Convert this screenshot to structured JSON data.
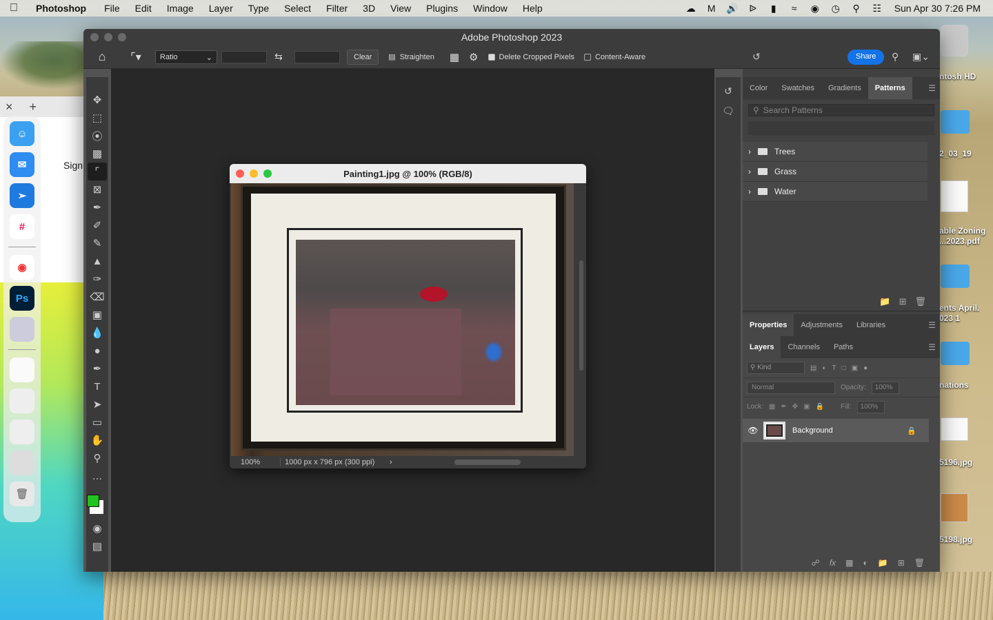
{
  "menubar": {
    "app": "Photoshop",
    "items": [
      "File",
      "Edit",
      "Image",
      "Layer",
      "Type",
      "Select",
      "Filter",
      "3D",
      "View",
      "Plugins",
      "Window",
      "Help"
    ],
    "clock": "Sun Apr 30  7:26 PM"
  },
  "browser": {
    "sign_text": "Sign"
  },
  "desktop": {
    "labels": [
      "ntosh HD",
      "2_03_19",
      "able Zoning\n...2023.pdf",
      "ents April.\n023 1",
      "nations",
      "5196.jpg",
      "5198.jpg"
    ]
  },
  "window": {
    "title": "Adobe Photoshop 2023"
  },
  "options": {
    "ratio": "Ratio",
    "clear": "Clear",
    "straighten": "Straighten",
    "delete_cropped": "Delete Cropped Pixels",
    "delete_cropped_checked": true,
    "content_aware": "Content-Aware",
    "content_aware_checked": false,
    "share": "Share"
  },
  "document": {
    "title": "Painting1.jpg @ 100% (RGB/8)",
    "zoom": "100%",
    "size": "1000 px x 796 px (300 ppi)"
  },
  "panel_top": {
    "tabs": [
      "Color",
      "Swatches",
      "Gradients",
      "Patterns"
    ],
    "active_tab": "Patterns",
    "search_placeholder": "Search Patterns",
    "groups": [
      "Trees",
      "Grass",
      "Water"
    ]
  },
  "panel_mid": {
    "tabs": [
      "Properties",
      "Adjustments",
      "Libraries"
    ],
    "active_tab": "Properties"
  },
  "panel_layers": {
    "tabs": [
      "Layers",
      "Channels",
      "Paths"
    ],
    "active_tab": "Layers",
    "kind_label": "Kind",
    "blend_mode": "Normal",
    "opacity_label": "Opacity:",
    "opacity_value": "100%",
    "lock_label": "Lock:",
    "fill_label": "Fill:",
    "fill_value": "100%",
    "layer_name": "Background"
  },
  "colors": {
    "foreground": "#22c21f",
    "background": "#ffffff",
    "share": "#1473e6"
  }
}
